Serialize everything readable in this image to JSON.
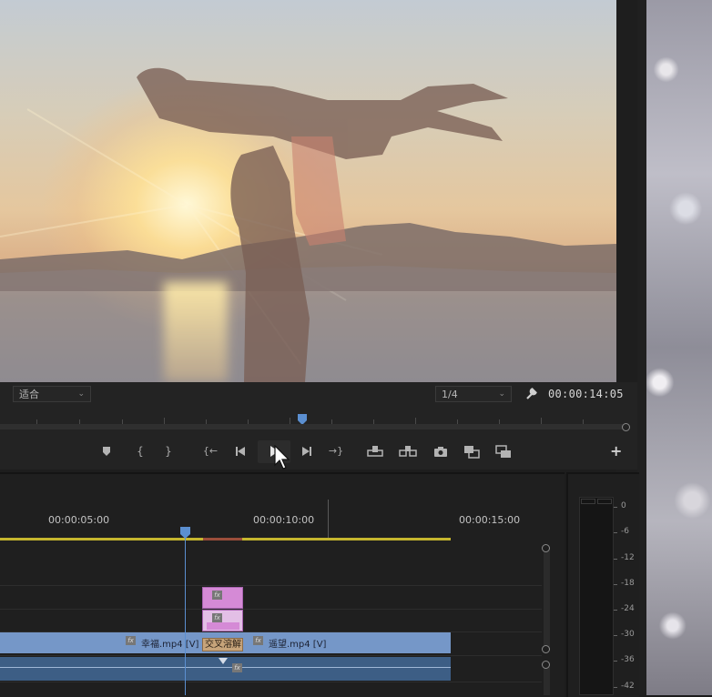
{
  "monitor": {
    "fit_label": "适合",
    "resolution_label": "1/4",
    "timecode": "00:00:14:05",
    "playback_progress": 0.48
  },
  "transport": {
    "buttons": [
      "add-marker",
      "mark-in",
      "mark-out",
      "go-to-in",
      "step-back",
      "play",
      "step-forward",
      "go-to-out",
      "lift",
      "extract",
      "export-frame",
      "insert",
      "overwrite"
    ],
    "add_button_label": "+"
  },
  "timeline": {
    "ruler_labels": [
      "00:00:05:00",
      "00:00:10:00",
      "00:00:15:00"
    ],
    "clip_v1_a_label": "幸福.mp4 [V]",
    "clip_v1_b_label": "遥望.mp4 [V]",
    "transition_label": "交叉溶解",
    "fx_badge": "fx"
  },
  "meter": {
    "scale": [
      "0",
      "-6",
      "-12",
      "-18",
      "-24",
      "-30",
      "-36",
      "-42"
    ]
  },
  "colors": {
    "clip_video": "#7597c8",
    "clip_audio": "#3d5e85",
    "clip_adjust": "#d58ad6",
    "work_area": "#c6b62e",
    "playhead": "#5b8fd0"
  }
}
